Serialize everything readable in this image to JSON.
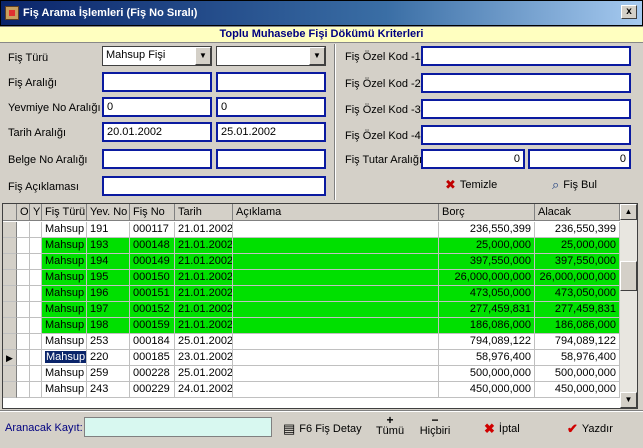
{
  "window": {
    "title": "Fiş Arama İşlemleri (Fiş No Sıralı)",
    "close": "x"
  },
  "criteria": {
    "header": "Toplu Muhasebe Fişi Dökümü Kriterleri",
    "fis_turu": {
      "label": "Fiş Türü",
      "value": "Mahsup Fişi",
      "value2": ""
    },
    "fis_araligi": {
      "label": "Fiş Aralığı",
      "from": "",
      "to": ""
    },
    "yevmiye": {
      "label": "Yevmiye No Aralığı",
      "from": "0",
      "to": "0"
    },
    "tarih": {
      "label": "Tarih Aralığı",
      "from": "20.01.2002",
      "to": "25.01.2002"
    },
    "belge": {
      "label": "Belge No Aralığı",
      "from": "",
      "to": ""
    },
    "aciklama": {
      "label": "Fiş Açıklaması",
      "value": ""
    },
    "ozel1": {
      "label": "Fiş Özel Kod -1",
      "value": ""
    },
    "ozel2": {
      "label": "Fiş Özel Kod -2",
      "value": ""
    },
    "ozel3": {
      "label": "Fiş Özel Kod -3",
      "value": ""
    },
    "ozel4": {
      "label": "Fiş Özel Kod -4",
      "value": ""
    },
    "tutar": {
      "label": "Fiş Tutar Aralığı",
      "from": "0",
      "to": "0"
    },
    "temizle": "Temizle",
    "fis_bul": "Fiş Bul"
  },
  "grid": {
    "headers": [
      "O",
      "Y",
      "Fiş Türü",
      "Yev. No",
      "Fiş No",
      "Tarih",
      "Açıklama",
      "Borç",
      "Alacak"
    ],
    "rows": [
      {
        "tur": "Mahsup",
        "yev": "191",
        "fis": "000117",
        "tarih": "21.01.2002",
        "ack": "",
        "borc": "236,550,399",
        "alacak": "236,550,399",
        "hl": false
      },
      {
        "tur": "Mahsup",
        "yev": "193",
        "fis": "000148",
        "tarih": "21.01.2002",
        "ack": "",
        "borc": "25,000,000",
        "alacak": "25,000,000",
        "hl": true
      },
      {
        "tur": "Mahsup",
        "yev": "194",
        "fis": "000149",
        "tarih": "21.01.2002",
        "ack": "",
        "borc": "397,550,000",
        "alacak": "397,550,000",
        "hl": true
      },
      {
        "tur": "Mahsup",
        "yev": "195",
        "fis": "000150",
        "tarih": "21.01.2002",
        "ack": "",
        "borc": "26,000,000,000",
        "alacak": "26,000,000,000",
        "hl": true
      },
      {
        "tur": "Mahsup",
        "yev": "196",
        "fis": "000151",
        "tarih": "21.01.2002",
        "ack": "",
        "borc": "473,050,000",
        "alacak": "473,050,000",
        "hl": true
      },
      {
        "tur": "Mahsup",
        "yev": "197",
        "fis": "000152",
        "tarih": "21.01.2002",
        "ack": "",
        "borc": "277,459,831",
        "alacak": "277,459,831",
        "hl": true
      },
      {
        "tur": "Mahsup",
        "yev": "198",
        "fis": "000159",
        "tarih": "21.01.2002",
        "ack": "",
        "borc": "186,086,000",
        "alacak": "186,086,000",
        "hl": true
      },
      {
        "tur": "Mahsup",
        "yev": "253",
        "fis": "000184",
        "tarih": "25.01.2002",
        "ack": "",
        "borc": "794,089,122",
        "alacak": "794,089,122",
        "hl": false
      },
      {
        "tur": "Mahsup",
        "yev": "220",
        "fis": "000185",
        "tarih": "23.01.2002",
        "ack": "",
        "borc": "58,976,400",
        "alacak": "58,976,400",
        "hl": false,
        "sel": true
      },
      {
        "tur": "Mahsup",
        "yev": "259",
        "fis": "000228",
        "tarih": "25.01.2002",
        "ack": "",
        "borc": "500,000,000",
        "alacak": "500,000,000",
        "hl": false
      },
      {
        "tur": "Mahsup",
        "yev": "243",
        "fis": "000229",
        "tarih": "24.01.2002",
        "ack": "",
        "borc": "450,000,000",
        "alacak": "450,000,000",
        "hl": false
      }
    ],
    "row_marker": "▶"
  },
  "bottom": {
    "search_label": "Aranacak Kayıt:",
    "search_value": "",
    "f6": "F6 Fiş Detay",
    "tumu": "Tümü",
    "hicbiri": "Hiçbiri",
    "iptal": "İptal",
    "yazdir": "Yazdır"
  },
  "colors": {
    "highlight": "#00e000",
    "field_border": "#0a1aa0",
    "selection": "#0a246a",
    "search_bg": "#d8f8f0"
  }
}
